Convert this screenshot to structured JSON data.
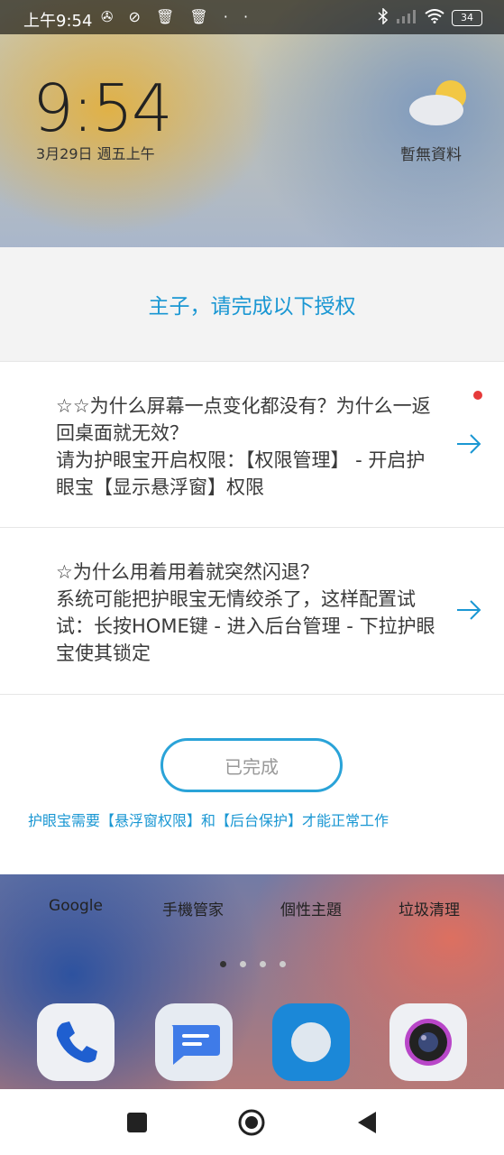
{
  "status_bar": {
    "time": "上午9:54",
    "left_icons": "✇ ⊘ 🗑 🗑 · ·",
    "battery": "34"
  },
  "widget": {
    "time": "9:54",
    "date": "3月29日 週五上午",
    "weather": "暫無資料"
  },
  "dialog": {
    "title": "主子，请完成以下授权",
    "items": [
      {
        "text": "☆☆为什么屏幕一点变化都没有？为什么一返回桌面就无效？\n请为护眼宝开启权限：【权限管理】 - 开启护眼宝【显示悬浮窗】权限",
        "badge": true
      },
      {
        "text": "☆为什么用着用着就突然闪退？\n系统可能把护眼宝无情绞杀了，这样配置试试：长按HOME键 - 进入后台管理 - 下拉护眼宝使其锁定",
        "badge": false
      }
    ],
    "done_button": "已完成",
    "note": "护眼宝需要【悬浮窗权限】和【后台保护】才能正常工作"
  },
  "home": {
    "apps": [
      "Google",
      "手機管家",
      "個性主題",
      "垃圾清理"
    ],
    "dock": [
      "phone-icon",
      "messages-icon",
      "browser-icon",
      "camera-icon"
    ]
  },
  "colors": {
    "accent": "#1a97d3",
    "badge": "#e63a3a"
  }
}
